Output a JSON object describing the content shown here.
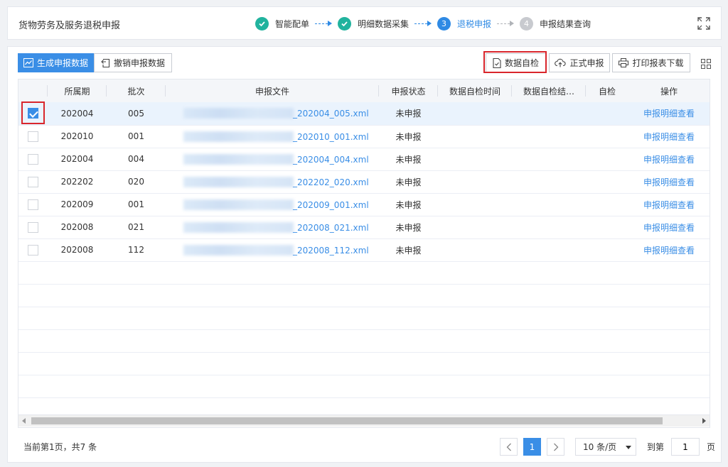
{
  "header": {
    "title": "货物劳务及服务退税申报",
    "steps": [
      {
        "num": "1",
        "label": "智能配单",
        "status": "done"
      },
      {
        "num": "2",
        "label": "明细数据采集",
        "status": "done"
      },
      {
        "num": "3",
        "label": "退税申报",
        "status": "active"
      },
      {
        "num": "4",
        "label": "申报结果查询",
        "status": "todo"
      }
    ]
  },
  "toolbar": {
    "generate_label": "生成申报数据",
    "revoke_label": "撤销申报数据",
    "selfcheck_label": "数据自检",
    "submit_label": "正式申报",
    "print_label": "打印报表下载"
  },
  "table": {
    "columns": [
      "所属期",
      "批次",
      "申报文件",
      "申报状态",
      "数据自检时间",
      "数据自检结…",
      "自检",
      "操作"
    ],
    "rows": [
      {
        "checked": true,
        "period": "202004",
        "batch": "005",
        "file": "_202004_005.xml",
        "status": "未申报",
        "action": "申报明细查看"
      },
      {
        "checked": false,
        "period": "202010",
        "batch": "001",
        "file": "_202010_001.xml",
        "status": "未申报",
        "action": "申报明细查看"
      },
      {
        "checked": false,
        "period": "202004",
        "batch": "004",
        "file": "_202004_004.xml",
        "status": "未申报",
        "action": "申报明细查看"
      },
      {
        "checked": false,
        "period": "202202",
        "batch": "020",
        "file": "_202202_020.xml",
        "status": "未申报",
        "action": "申报明细查看"
      },
      {
        "checked": false,
        "period": "202009",
        "batch": "001",
        "file": "_202009_001.xml",
        "status": "未申报",
        "action": "申报明细查看"
      },
      {
        "checked": false,
        "period": "202008",
        "batch": "021",
        "file": "_202008_021.xml",
        "status": "未申报",
        "action": "申报明细查看"
      },
      {
        "checked": false,
        "period": "202008",
        "batch": "112",
        "file": "_202008_112.xml",
        "status": "未申报",
        "action": "申报明细查看"
      }
    ]
  },
  "pagination": {
    "summary": "当前第1页，共7 条",
    "current_page": "1",
    "page_size": "10 条/页",
    "goto_label": "到第",
    "goto_value": "1",
    "unit": "页"
  },
  "colors": {
    "primary": "#3a8ee6",
    "done": "#21b39e",
    "highlight": "#d9262c"
  }
}
